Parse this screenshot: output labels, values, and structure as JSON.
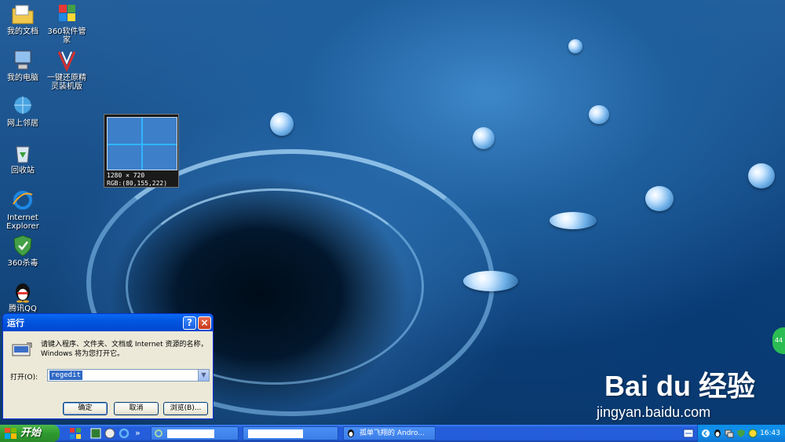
{
  "desktop": {
    "icons": [
      {
        "label": "我的文档",
        "icon": "my-documents-icon"
      },
      {
        "label": "360软件管家",
        "icon": "360-software-manager-icon"
      },
      {
        "label": "我的电脑",
        "icon": "my-computer-icon"
      },
      {
        "label": "一键还原精灵装机版",
        "icon": "one-key-restore-icon"
      },
      {
        "label": "网上邻居",
        "icon": "network-places-icon"
      },
      {
        "label": "回收站",
        "icon": "recycle-bin-icon"
      },
      {
        "label": "Internet Explorer",
        "icon": "internet-explorer-icon"
      },
      {
        "label": "360杀毒",
        "icon": "360-antivirus-icon"
      },
      {
        "label": "腾讯QQ",
        "icon": "qq-penguin-icon"
      }
    ]
  },
  "color_picker": {
    "resolution": "1280 × 720",
    "rgb": "RGB:(80,155,222)",
    "color": "#509bde"
  },
  "run_dialog": {
    "title": "运行",
    "help_button": "?",
    "close_button": "×",
    "message": "请键入程序、文件夹、文档或 Internet 资源的名称，Windows 将为您打开它。",
    "open_label": "打开(O):",
    "input_value": "regedit",
    "ok_label": "确定",
    "cancel_label": "取消",
    "browse_label": "浏览(B)..."
  },
  "taskbar": {
    "start_label": "开始",
    "chevron": "»",
    "windows": [
      {
        "label": "",
        "icon": "ie-icon",
        "redacted": true
      },
      {
        "label": "",
        "icon": "window-icon",
        "redacted": true
      },
      {
        "label": "孤单飞翔的 Andro...",
        "icon": "qq-penguin-icon"
      }
    ],
    "clock": "16:43"
  },
  "watermark": {
    "brand": "Bai du 经验",
    "url": "jingyan.baidu.com"
  },
  "side_badge": "44",
  "colors": {
    "taskbar_blue": "#245edb",
    "start_green": "#2f9a2f",
    "dialog_face": "#ece9d8",
    "title_blue": "#0256e0"
  }
}
